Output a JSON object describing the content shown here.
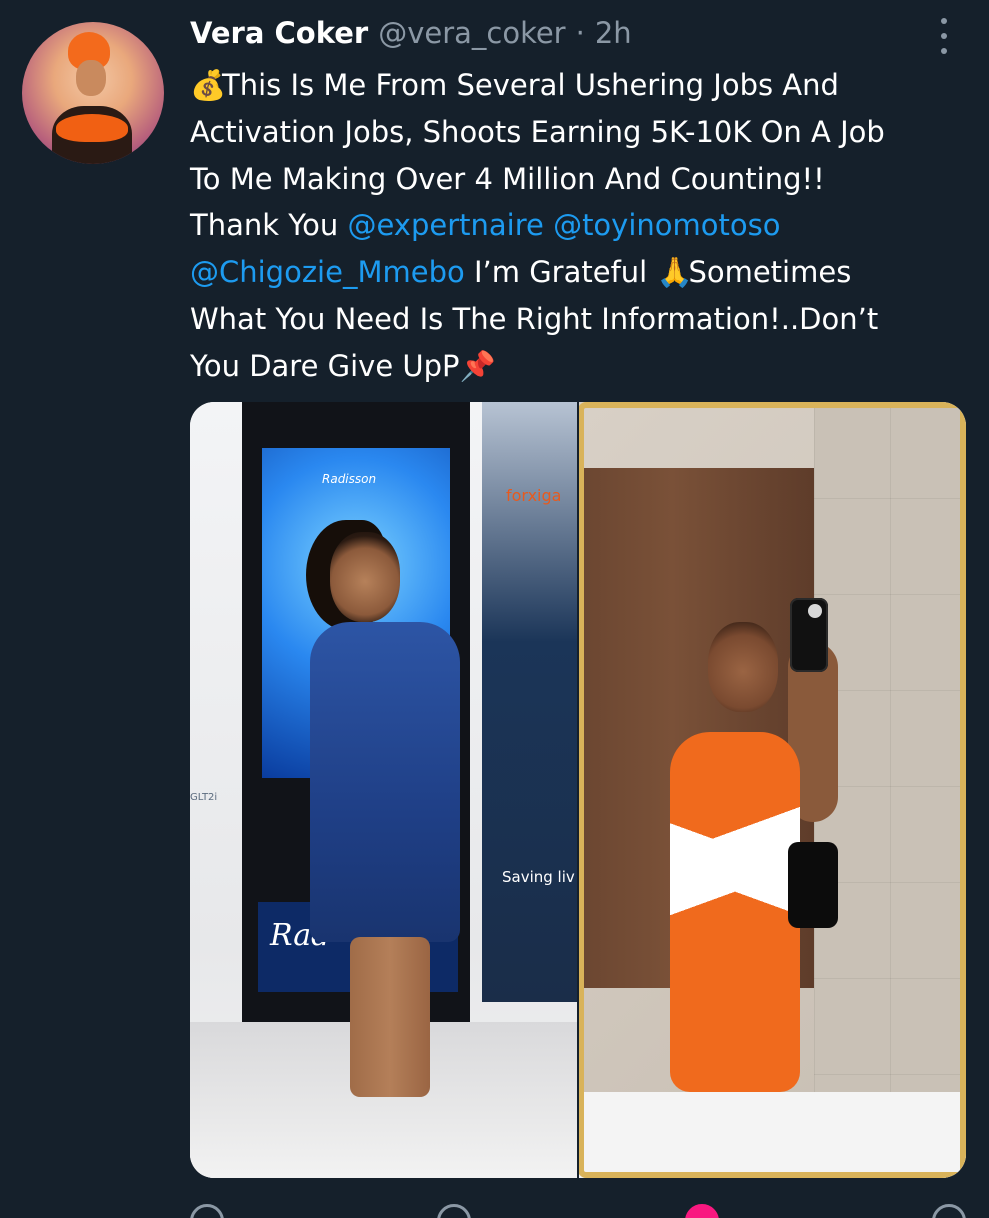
{
  "tweet": {
    "author_name": "Vera Coker",
    "author_handle": "@vera_coker",
    "separator": "·",
    "time": "2h",
    "text": {
      "line1_prefix": "💰",
      "line1": "This Is Me From Several Ushering Jobs And",
      "line2": "Activation Jobs, Shoots Earning 5K-10K On A Job",
      "line3": "To Me Making Over 4 Million And Counting!!",
      "line4_prefix": "Thank You ",
      "mention1": "@expertnaire",
      "line4_space": " ",
      "mention2": "@toyinomotoso",
      "mention3": "@Chigozie_Mmebo",
      "line5_suffix": " I’m Grateful ",
      "line5_emoji": "🙏",
      "line5_end": "Sometimes",
      "line6": "What You Need Is The Right Information!..Don’t",
      "line7": "You Dare Give UpP",
      "line7_emoji": "📌"
    }
  },
  "media": {
    "left_photo": {
      "screen_brand": "Radisson",
      "banner_brand": "forxiga",
      "banner_subtext": "Saving liv",
      "plaque_text": "Rad",
      "stand_sign": "GLT2i"
    }
  },
  "colors": {
    "background": "#15202b",
    "text_primary": "#ffffff",
    "text_secondary": "#8b98a5",
    "link": "#1d9bf0",
    "like": "#f91880"
  },
  "icons": {
    "more": "more-vertical-icon",
    "reply": "reply-icon",
    "retweet": "retweet-icon",
    "like": "heart-icon",
    "share": "share-icon"
  }
}
